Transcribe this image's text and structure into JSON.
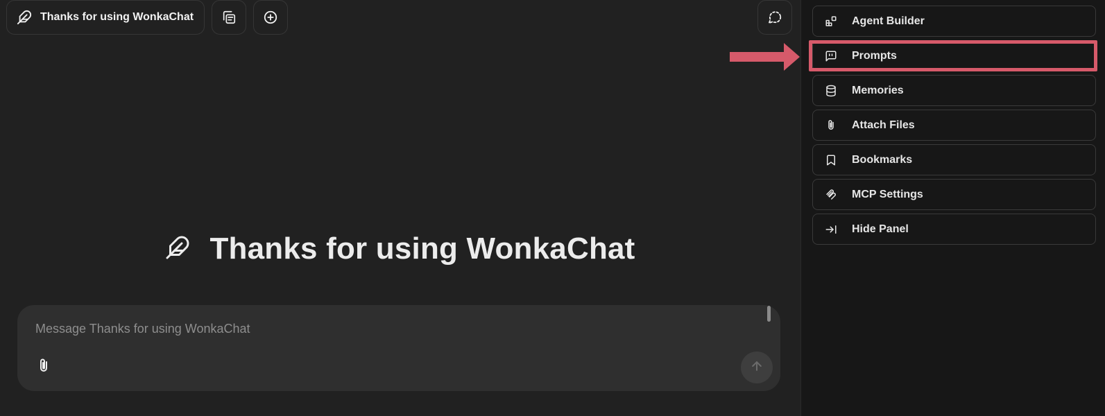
{
  "header": {
    "model_label": "Thanks for using WonkaChat",
    "model_icon": "feather-icon",
    "copy_icon": "copy-icon",
    "new_chat_icon": "plus-circle-icon",
    "temporary_chat_icon": "dashed-chat-icon"
  },
  "welcome": {
    "title": "Thanks for using WonkaChat",
    "icon": "feather-icon"
  },
  "composer": {
    "placeholder": "Message Thanks for using WonkaChat",
    "attach_icon": "paperclip-icon",
    "send_icon": "arrow-up-icon"
  },
  "side_panel": {
    "items": [
      {
        "label": "Agent Builder",
        "icon": "blocks-icon"
      },
      {
        "label": "Prompts",
        "icon": "message-quote-icon"
      },
      {
        "label": "Memories",
        "icon": "database-icon"
      },
      {
        "label": "Attach Files",
        "icon": "paperclip-icon"
      },
      {
        "label": "Bookmarks",
        "icon": "bookmark-icon"
      },
      {
        "label": "MCP Settings",
        "icon": "mcp-icon"
      },
      {
        "label": "Hide Panel",
        "icon": "arrow-right-to-line-icon"
      }
    ]
  },
  "annotation": {
    "highlight_color": "#d65a6a",
    "highlighted_item": "Prompts"
  },
  "colors": {
    "background": "#212121",
    "panel_background": "#171717",
    "composer_background": "#2f2f2f",
    "text": "#ececec"
  }
}
